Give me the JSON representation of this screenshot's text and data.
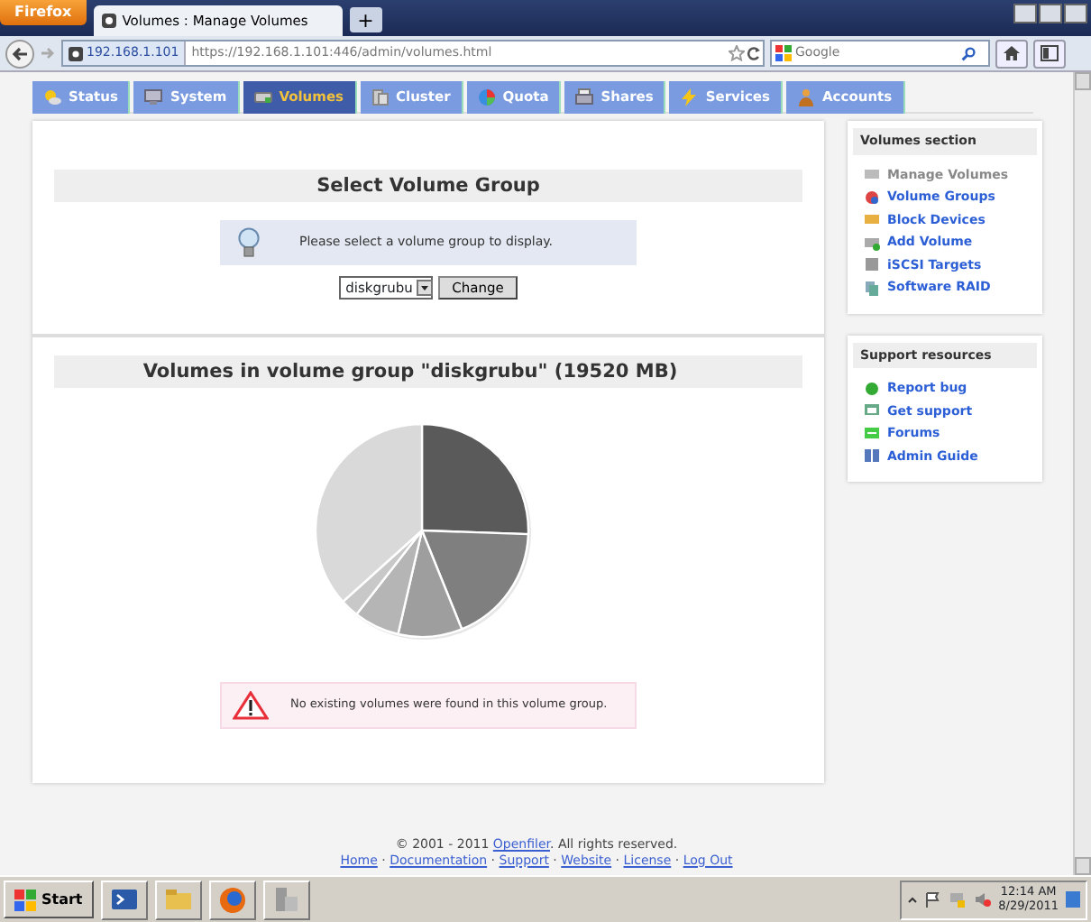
{
  "browser": {
    "app_button": "Firefox",
    "tab_title": "Volumes : Manage Volumes",
    "new_tab": "+",
    "identity": "192.168.1.101",
    "url": "https://192.168.1.101:446/admin/volumes.html",
    "search": {
      "placeholder": "Google"
    }
  },
  "tabs": [
    {
      "label": "Status",
      "selected": false
    },
    {
      "label": "System",
      "selected": false
    },
    {
      "label": "Volumes",
      "selected": true
    },
    {
      "label": "Cluster",
      "selected": false
    },
    {
      "label": "Quota",
      "selected": false
    },
    {
      "label": "Shares",
      "selected": false
    },
    {
      "label": "Services",
      "selected": false
    },
    {
      "label": "Accounts",
      "selected": false
    }
  ],
  "main": {
    "select_heading": "Select Volume Group",
    "info": "Please select a volume group to display.",
    "volume_group": {
      "value": "diskgrubu"
    },
    "change_button": "Change",
    "volumes_heading": "Volumes in volume group \"diskgrubu\" (19520 MB)",
    "warning": "No existing volumes were found in this volume group."
  },
  "sidebar": [
    {
      "title": "Volumes section",
      "items": [
        {
          "label": "Manage Volumes",
          "selected": true
        },
        {
          "label": "Volume Groups",
          "selected": false
        },
        {
          "label": "Block Devices",
          "selected": false
        },
        {
          "label": "Add Volume",
          "selected": false
        },
        {
          "label": "iSCSI Targets",
          "selected": false
        },
        {
          "label": "Software RAID",
          "selected": false
        }
      ]
    },
    {
      "title": "Support resources",
      "items": [
        {
          "label": "Report bug",
          "selected": false
        },
        {
          "label": "Get support",
          "selected": false
        },
        {
          "label": "Forums",
          "selected": false
        },
        {
          "label": "Admin Guide",
          "selected": false
        }
      ]
    }
  ],
  "footer": {
    "copyright_before": "© 2001 - 2011 ",
    "copyright_link": "Openfiler",
    "copyright_after": ". All rights reserved.",
    "separator": "·",
    "links": [
      "Home",
      "Documentation",
      "Support",
      "Website",
      "License",
      "Log Out"
    ]
  },
  "taskbar": {
    "start": "Start",
    "time": "12:14 AM",
    "date": "8/29/2011"
  }
}
